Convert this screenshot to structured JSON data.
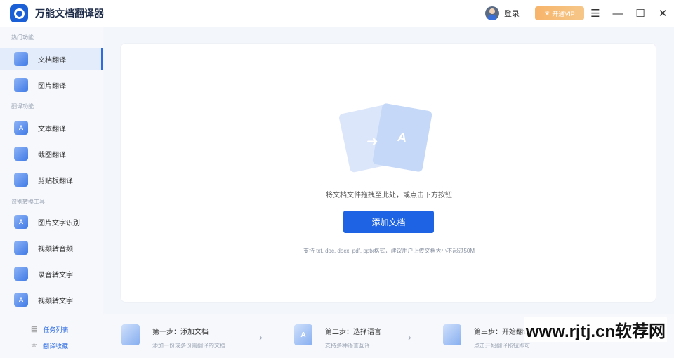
{
  "app": {
    "title": "万能文档翻译器"
  },
  "titlebar": {
    "login_label": "登录",
    "vip_label": "开通VIP"
  },
  "sidebar": {
    "sections": [
      "热门功能",
      "翻译功能",
      "识别转换工具"
    ],
    "items": [
      {
        "label": "文档翻译",
        "icon": "document-icon",
        "glyph": ""
      },
      {
        "label": "图片翻译",
        "icon": "image-icon",
        "glyph": ""
      },
      {
        "label": "文本翻译",
        "icon": "text-icon",
        "glyph": "A"
      },
      {
        "label": "截图翻译",
        "icon": "screenshot-icon",
        "glyph": ""
      },
      {
        "label": "剪贴板翻译",
        "icon": "clipboard-icon",
        "glyph": ""
      },
      {
        "label": "图片文字识别",
        "icon": "ocr-icon",
        "glyph": "A"
      },
      {
        "label": "视频转音频",
        "icon": "video-icon",
        "glyph": ""
      },
      {
        "label": "录音转文字",
        "icon": "microphone-icon",
        "glyph": ""
      },
      {
        "label": "视频转文字",
        "icon": "video-text-icon",
        "glyph": "A"
      }
    ],
    "bottom": [
      {
        "label": "任务列表",
        "icon": "task-list-icon"
      },
      {
        "label": "翻译收藏",
        "icon": "star-icon"
      }
    ]
  },
  "main": {
    "drop_hint": "将文档文件拖拽至此处，或点击下方按钮",
    "add_button": "添加文档",
    "format_note": "支持 txt, doc, docx, pdf, pptx格式，建议用户上传文档大小不超过50M"
  },
  "steps": [
    {
      "title": "第一步：添加文档",
      "sub": "添加一份或多份需翻译的文档",
      "glyph": ""
    },
    {
      "title": "第二步：选择语言",
      "sub": "支持多种语言互译",
      "glyph": "A"
    },
    {
      "title": "第三步：开始翻译",
      "sub": "点击开始翻译按钮即可",
      "glyph": ""
    }
  ],
  "watermark": "www.rjtj.cn软荐网"
}
